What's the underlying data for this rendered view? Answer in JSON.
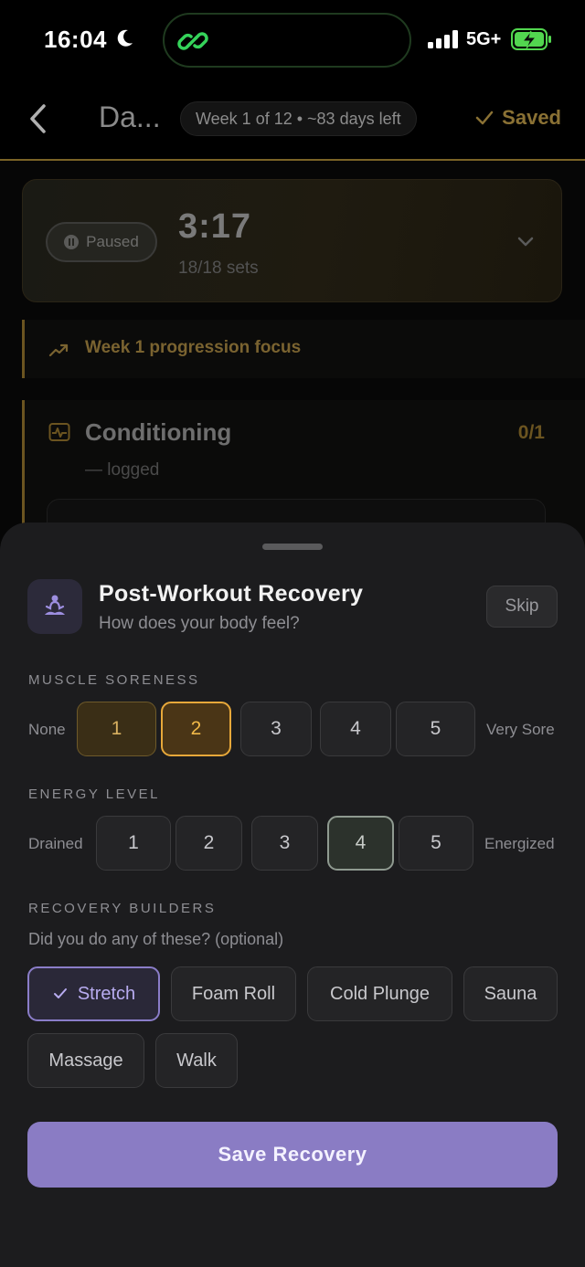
{
  "status_bar": {
    "time": "16:04",
    "network": "5G+",
    "icons": [
      "moon-icon",
      "activity-link-icon",
      "signal-icon",
      "battery-charging-icon"
    ]
  },
  "header": {
    "back_icon": "chevron-left-icon",
    "title": "Da...",
    "week_pill": "Week 1 of 12 • ~83 days left",
    "saved_label": "Saved",
    "saved_icon": "check-icon"
  },
  "timer_card": {
    "status": "Paused",
    "elapsed": "3:17",
    "sets": "18/18 sets",
    "expand_icon": "chevron-down-icon"
  },
  "focus": {
    "icon": "trending-up-icon",
    "label": "Week 1 progression focus"
  },
  "conditioning": {
    "icon": "heart-monitor-icon",
    "title": "Conditioning",
    "count": "0/1",
    "subtitle": "— logged"
  },
  "recovery": {
    "icon": "meditation-icon",
    "title": "Post-Workout Recovery",
    "subtitle": "How does your body feel?",
    "skip_label": "Skip",
    "soreness": {
      "label": "MUSCLE SORENESS",
      "low_label": "None",
      "high_label": "Very Sore",
      "options": [
        "1",
        "2",
        "3",
        "4",
        "5"
      ],
      "selected": "2"
    },
    "energy": {
      "label": "ENERGY LEVEL",
      "low_label": "Drained",
      "high_label": "Energized",
      "options": [
        "1",
        "2",
        "3",
        "4",
        "5"
      ],
      "selected": "4"
    },
    "builders": {
      "label": "RECOVERY BUILDERS",
      "question": "Did you do any of these? (optional)",
      "options": [
        "Stretch",
        "Foam Roll",
        "Cold Plunge",
        "Sauna",
        "Massage",
        "Walk"
      ],
      "selected": [
        "Stretch"
      ]
    },
    "save_label": "Save Recovery"
  },
  "colors": {
    "accent_gold": "#e7a83a",
    "accent_purple": "#8a7cc4",
    "sheet_bg": "#1c1c1e",
    "island_green": "#35d35a",
    "battery_green": "#52d64f"
  }
}
